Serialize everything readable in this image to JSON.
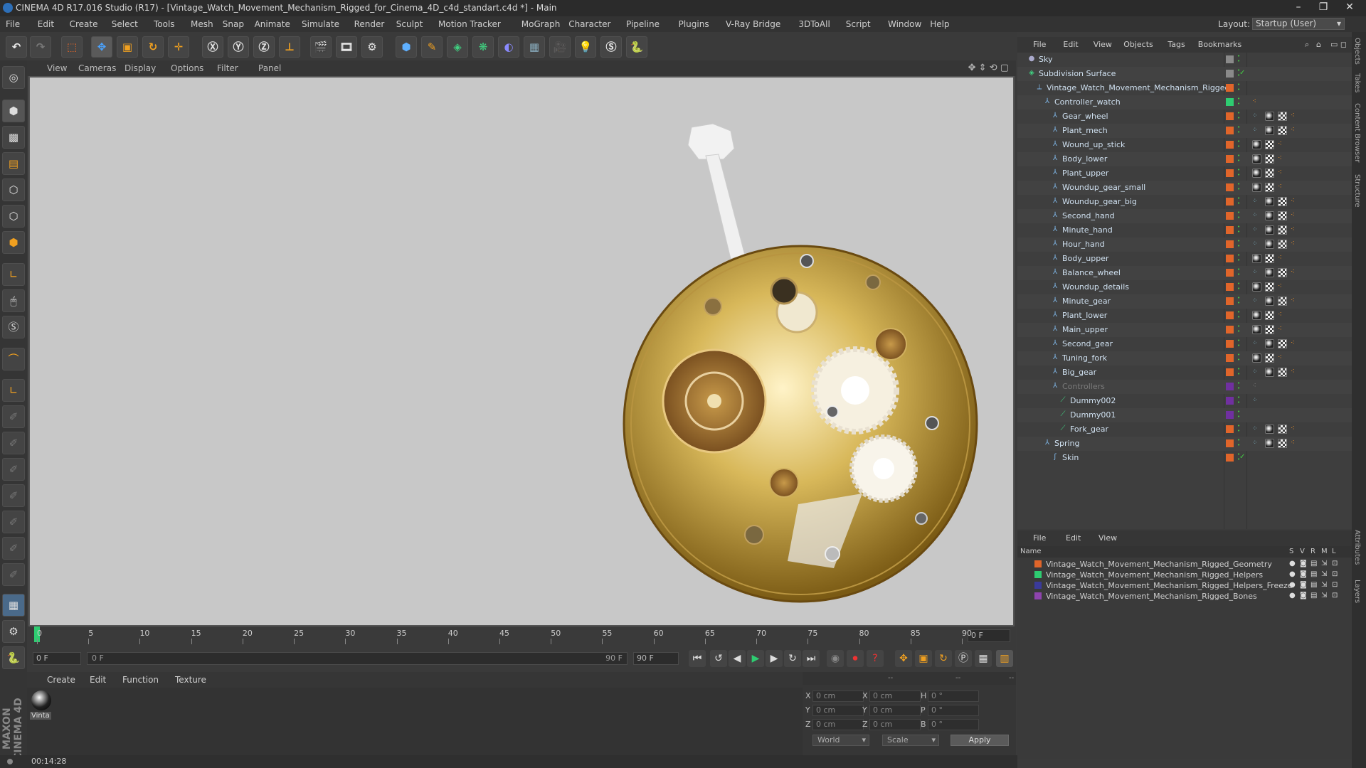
{
  "title": "CINEMA 4D R17.016 Studio (R17) - [Vintage_Watch_Movement_Mechanism_Rigged_for_Cinema_4D_c4d_standart.c4d *] - Main",
  "menu": [
    "File",
    "Edit",
    "Create",
    "Select",
    "Tools",
    "Mesh",
    "Snap",
    "Animate",
    "Simulate",
    "Render",
    "Sculpt",
    "Motion Tracker",
    "MoGraph",
    "Character",
    "Pipeline",
    "Plugins",
    "V-Ray Bridge",
    "3DToAll",
    "Script",
    "Window",
    "Help"
  ],
  "layout": {
    "label": "Layout:",
    "value": "Startup (User)"
  },
  "viewport_menu": [
    "View",
    "Cameras",
    "Display",
    "Options",
    "Filter",
    "Panel"
  ],
  "timeline": {
    "ticks": [
      "0",
      "5",
      "10",
      "15",
      "20",
      "25",
      "30",
      "35",
      "40",
      "45",
      "50",
      "55",
      "60",
      "65",
      "70",
      "75",
      "80",
      "85",
      "90"
    ],
    "current_frame": "0 F",
    "start": "0 F",
    "range_start": "0 F",
    "range_end": "90 F",
    "end": "90 F"
  },
  "material_menu": [
    "Create",
    "Edit",
    "Function",
    "Texture"
  ],
  "material": {
    "label": "Vinta"
  },
  "coords": {
    "header": [
      "--",
      "--",
      "--"
    ],
    "rows": [
      {
        "a": "X",
        "v1": "0 cm",
        "b": "X",
        "v2": "0 cm",
        "c": "H",
        "v3": "0 °"
      },
      {
        "a": "Y",
        "v1": "0 cm",
        "b": "Y",
        "v2": "0 cm",
        "c": "P",
        "v3": "0 °"
      },
      {
        "a": "Z",
        "v1": "0 cm",
        "b": "Z",
        "v2": "0 cm",
        "c": "B",
        "v3": "0 °"
      }
    ],
    "mode": "World",
    "scale": "Scale",
    "apply": "Apply"
  },
  "status": {
    "time": "00:14:28"
  },
  "object_menu": [
    "File",
    "Edit",
    "View",
    "Objects",
    "Tags",
    "Bookmarks"
  ],
  "objects": [
    {
      "name": "Sky",
      "depth": 0,
      "icon": "sky",
      "layer": "#8a8a8a",
      "tags": []
    },
    {
      "name": "Subdivision Surface",
      "depth": 0,
      "icon": "subd",
      "layer": "#8a8a8a",
      "tags": [
        "check"
      ]
    },
    {
      "name": "Vintage_Watch_Movement_Mechanism_Rigged",
      "depth": 1,
      "icon": "null",
      "layer": "#e0652a",
      "tags": []
    },
    {
      "name": "Controller_watch",
      "depth": 2,
      "icon": "joint",
      "layer": "#2ecc71",
      "tags": [
        "dot"
      ]
    },
    {
      "name": "Gear_wheel",
      "depth": 3,
      "icon": "joint",
      "layer": "#e0652a",
      "tags": [
        "ik",
        "mat",
        "chk",
        "dot"
      ]
    },
    {
      "name": "Plant_mech",
      "depth": 3,
      "icon": "joint",
      "layer": "#e0652a",
      "tags": [
        "ik",
        "mat",
        "chk",
        "dot"
      ]
    },
    {
      "name": "Wound_up_stick",
      "depth": 3,
      "icon": "joint",
      "layer": "#e0652a",
      "tags": [
        "mat",
        "chk",
        "dot"
      ]
    },
    {
      "name": "Body_lower",
      "depth": 3,
      "icon": "joint",
      "layer": "#e0652a",
      "tags": [
        "mat",
        "chk",
        "dot"
      ]
    },
    {
      "name": "Plant_upper",
      "depth": 3,
      "icon": "joint",
      "layer": "#e0652a",
      "tags": [
        "mat",
        "chk",
        "dot"
      ]
    },
    {
      "name": "Woundup_gear_small",
      "depth": 3,
      "icon": "joint",
      "layer": "#e0652a",
      "tags": [
        "mat",
        "chk",
        "dot"
      ]
    },
    {
      "name": "Woundup_gear_big",
      "depth": 3,
      "icon": "joint",
      "layer": "#e0652a",
      "tags": [
        "ik",
        "mat",
        "chk",
        "dot"
      ]
    },
    {
      "name": "Second_hand",
      "depth": 3,
      "icon": "joint",
      "layer": "#e0652a",
      "tags": [
        "ik",
        "mat",
        "chk",
        "dot"
      ]
    },
    {
      "name": "Minute_hand",
      "depth": 3,
      "icon": "joint",
      "layer": "#e0652a",
      "tags": [
        "ik",
        "mat",
        "chk",
        "dot"
      ]
    },
    {
      "name": "Hour_hand",
      "depth": 3,
      "icon": "joint",
      "layer": "#e0652a",
      "tags": [
        "ik",
        "mat",
        "chk",
        "dot"
      ]
    },
    {
      "name": "Body_upper",
      "depth": 3,
      "icon": "joint",
      "layer": "#e0652a",
      "tags": [
        "mat",
        "chk",
        "dot"
      ]
    },
    {
      "name": "Balance_wheel",
      "depth": 3,
      "icon": "joint",
      "layer": "#e0652a",
      "tags": [
        "ik",
        "mat",
        "chk",
        "dot"
      ]
    },
    {
      "name": "Woundup_details",
      "depth": 3,
      "icon": "joint",
      "layer": "#e0652a",
      "tags": [
        "mat",
        "chk",
        "dot"
      ]
    },
    {
      "name": "Minute_gear",
      "depth": 3,
      "icon": "joint",
      "layer": "#e0652a",
      "tags": [
        "ik",
        "mat",
        "chk",
        "dot"
      ]
    },
    {
      "name": "Plant_lower",
      "depth": 3,
      "icon": "joint",
      "layer": "#e0652a",
      "tags": [
        "mat",
        "chk",
        "dot"
      ]
    },
    {
      "name": "Main_upper",
      "depth": 3,
      "icon": "joint",
      "layer": "#e0652a",
      "tags": [
        "mat",
        "chk",
        "dot"
      ]
    },
    {
      "name": "Second_gear",
      "depth": 3,
      "icon": "joint",
      "layer": "#e0652a",
      "tags": [
        "ik",
        "mat",
        "chk",
        "dot"
      ]
    },
    {
      "name": "Tuning_fork",
      "depth": 3,
      "icon": "joint",
      "layer": "#e0652a",
      "tags": [
        "mat",
        "chk",
        "dot"
      ]
    },
    {
      "name": "Big_gear",
      "depth": 3,
      "icon": "joint",
      "layer": "#e0652a",
      "tags": [
        "ik",
        "mat",
        "chk",
        "dot"
      ]
    },
    {
      "name": "Controllers",
      "depth": 3,
      "icon": "joint",
      "layer": "#7030a0",
      "tags": [
        "grey"
      ]
    },
    {
      "name": "Dummy002",
      "depth": 4,
      "icon": "bone",
      "layer": "#7030a0",
      "tags": [
        "ik"
      ]
    },
    {
      "name": "Dummy001",
      "depth": 4,
      "icon": "bone",
      "layer": "#7030a0",
      "tags": []
    },
    {
      "name": "Fork_gear",
      "depth": 4,
      "icon": "bone",
      "layer": "#e0652a",
      "tags": [
        "ik",
        "mat",
        "chk",
        "dot"
      ]
    },
    {
      "name": "Spring",
      "depth": 2,
      "icon": "joint",
      "layer": "#e0652a",
      "tags": [
        "ik",
        "mat",
        "chk",
        "dot"
      ]
    },
    {
      "name": "Skin",
      "depth": 3,
      "icon": "skin",
      "layer": "#e0652a",
      "tags": [
        "check"
      ]
    }
  ],
  "layers_menu": [
    "File",
    "Edit",
    "View"
  ],
  "layers_header": {
    "name": "Name",
    "cols": [
      "S",
      "V",
      "R",
      "M",
      "L"
    ]
  },
  "layers": [
    {
      "name": "Vintage_Watch_Movement_Mechanism_Rigged_Geometry",
      "color": "#e0652a"
    },
    {
      "name": "Vintage_Watch_Movement_Mechanism_Rigged_Helpers",
      "color": "#2ecc71"
    },
    {
      "name": "Vintage_Watch_Movement_Mechanism_Rigged_Helpers_Freeze",
      "color": "#3a3a9a"
    },
    {
      "name": "Vintage_Watch_Movement_Mechanism_Rigged_Bones",
      "color": "#8e44ad"
    }
  ],
  "side_tabs": [
    "Objects",
    "Takes",
    "Content Browser",
    "Structure",
    "Attributes",
    "Layers"
  ],
  "brand": "MAXON CINEMA 4D"
}
